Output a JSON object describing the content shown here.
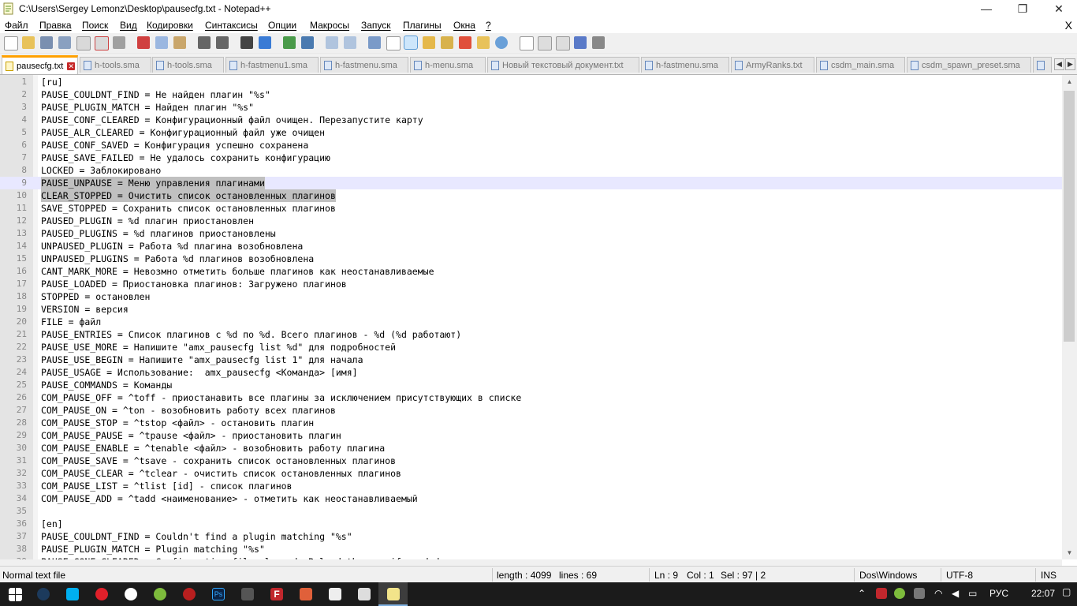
{
  "window": {
    "title": "C:\\Users\\Sergey Lemonz\\Desktop\\pausecfg.txt - Notepad++"
  },
  "window_controls": {
    "minimize": "—",
    "maximize": "❐",
    "close": "✕"
  },
  "menu": {
    "items": [
      "Файл",
      "Правка",
      "Поиск",
      "Вид",
      "Кодировки",
      "Синтаксисы",
      "Опции",
      "Макросы",
      "Запуск",
      "Плагины",
      "Окна",
      "?"
    ],
    "close": "X"
  },
  "toolbar": {
    "icons": [
      "new-file-icon",
      "open-file-icon",
      "save-icon",
      "save-all-icon",
      "close-icon",
      "close-all-icon",
      "print-icon",
      "cut-icon",
      "copy-icon",
      "paste-icon",
      "undo-icon",
      "redo-icon",
      "find-icon",
      "replace-icon",
      "zoom-in-icon",
      "zoom-out-icon",
      "sync-vertical-icon",
      "sync-horizontal-icon",
      "word-wrap-icon",
      "show-all-chars-icon",
      "indent-guide-icon",
      "language-icon",
      "doc-map-icon",
      "function-list-icon",
      "folder-workspace-icon",
      "monitoring-icon",
      "record-macro-icon",
      "stop-record-icon",
      "play-macro-icon",
      "run-macro-multiple-icon",
      "save-macro-icon"
    ]
  },
  "tabs": [
    "pausecfg.txt",
    "h-tools.sma",
    "h-tools.sma",
    "h-fastmenu1.sma",
    "h-fastmenu.sma",
    "h-menu.sma",
    "Новый текстовый документ.txt",
    "h-fastmenu.sma",
    "ArmyRanks.txt",
    "csdm_main.sma",
    "csdm_spawn_preset.sma"
  ],
  "tab_arrows": {
    "left": "◀",
    "right": "▶"
  },
  "editor": {
    "lines": [
      "[ru]",
      "PAUSE_COULDNT_FIND = Не найден плагин \"%s\"",
      "PAUSE_PLUGIN_MATCH = Найден плагин \"%s\"",
      "PAUSE_CONF_CLEARED = Конфигурационный файл очищен. Перезапустите карту",
      "PAUSE_ALR_CLEARED = Конфигурационный файл уже очищен",
      "PAUSE_CONF_SAVED = Конфигурация успешно сохранена",
      "PAUSE_SAVE_FAILED = Не удалось сохранить конфигурацию",
      "LOCKED = Заблокировано",
      "PAUSE_UNPAUSE = Меню управления плагинами",
      "CLEAR_STOPPED = Очистить список остановленных плагинов",
      "SAVE_STOPPED = Сохранить список остановленных плагинов",
      "PAUSED_PLUGIN = %d плагин приостановлен",
      "PAUSED_PLUGINS = %d плагинов приостановлены",
      "UNPAUSED_PLUGIN = Работа %d плагина возобновлена",
      "UNPAUSED_PLUGINS = Работа %d плагинов возобновлена",
      "CANT_MARK_MORE = Невозмно отметить больше плагинов как неостанавливаемые",
      "PAUSE_LOADED = Приостановка плагинов: Загружено плагинов",
      "STOPPED = остановлен",
      "VERSION = версия",
      "FILE = файл",
      "PAUSE_ENTRIES = Список плагинов с %d по %d. Всего плагинов - %d (%d работают)",
      "PAUSE_USE_MORE = Напишите \"amx_pausecfg list %d\" для подробностей",
      "PAUSE_USE_BEGIN = Напишите \"amx_pausecfg list 1\" для начала",
      "PAUSE_USAGE = Использование:  amx_pausecfg <Команда> [имя]",
      "PAUSE_COMMANDS = Команды",
      "COM_PAUSE_OFF = ^toff - приостанавить все плагины за исключением присутствующих в списке",
      "COM_PAUSE_ON = ^ton - возобновить работу всех плагинов",
      "COM_PAUSE_STOP = ^tstop <файл> - остановить плагин",
      "COM_PAUSE_PAUSE = ^tpause <файл> - приостановить плагин",
      "COM_PAUSE_ENABLE = ^tenable <файл> - возобновить работу плагина",
      "COM_PAUSE_SAVE = ^tsave - сохранить список остановленных плагинов",
      "COM_PAUSE_CLEAR = ^tclear - очистить список остановленных плагинов",
      "COM_PAUSE_LIST = ^tlist [id] - список плагинов",
      "COM_PAUSE_ADD = ^tadd <наименование> - отметить как неостанавливаемый",
      "",
      "[en]",
      "PAUSE_COULDNT_FIND = Couldn't find a plugin matching \"%s\"",
      "PAUSE_PLUGIN_MATCH = Plugin matching \"%s\"",
      "PAUSE_CONF_CLEARED = Configuration file cleared. Reload the map if needed"
    ],
    "current_line": 9,
    "selected_lines": [
      9,
      10
    ]
  },
  "scrollbar": {
    "up": "▲",
    "down": "▼"
  },
  "status": {
    "type": "Normal text file",
    "length": "length : 4099",
    "lines": "lines : 69",
    "ln": "Ln : 9",
    "col": "Col : 1",
    "sel": "Sel : 97 | 2",
    "eol": "Dos\\Windows",
    "encoding": "UTF-8",
    "mode": "INS"
  },
  "taskbar": {
    "apps": [
      "windows-start-icon",
      "steam-icon",
      "skype-icon",
      "opera-icon",
      "yandex-browser-icon",
      "utorrent-icon",
      "record-app-icon",
      "photoshop-icon",
      "film-app-icon",
      "filezilla-icon",
      "game-app-icon",
      "typora-icon",
      "app-icon",
      "notepadpp-icon"
    ],
    "photoshop_label": "Ps",
    "filezilla_label": "F",
    "lang": "РУС",
    "time": "22:07"
  },
  "colors": {
    "accent_tab": "#ffa000",
    "selection": "#c0c0c0",
    "current_line": "#e8e8ff",
    "taskbar": "#1b1b1b"
  }
}
